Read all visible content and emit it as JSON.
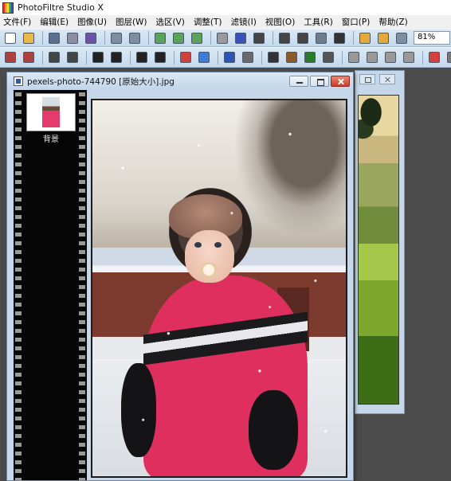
{
  "window": {
    "title": "PhotoFiltre Studio X"
  },
  "menu": {
    "items": [
      {
        "label": "文件(F)"
      },
      {
        "label": "编辑(E)"
      },
      {
        "label": "图像(U)"
      },
      {
        "label": "图层(W)"
      },
      {
        "label": "选区(V)"
      },
      {
        "label": "调整(T)"
      },
      {
        "label": "滤镜(I)"
      },
      {
        "label": "视图(O)"
      },
      {
        "label": "工具(R)"
      },
      {
        "label": "窗口(P)"
      },
      {
        "label": "帮助(Z)"
      }
    ]
  },
  "toolbar1": {
    "buttons": [
      {
        "icon": "new-file-icon",
        "color": "#ffffff"
      },
      {
        "icon": "open-folder-icon",
        "color": "#e9b84a"
      },
      {
        "icon": "save-icon",
        "color": "#5a6f8e"
      },
      {
        "icon": "print-icon",
        "color": "#8c8fa3"
      },
      {
        "icon": "scan-icon",
        "color": "#6a52a8"
      },
      {
        "icon": "undo-icon",
        "color": "#7d8ea0"
      },
      {
        "icon": "redo-icon",
        "color": "#7d8ea0"
      },
      {
        "icon": "copy-icon",
        "color": "#5aa35a"
      },
      {
        "icon": "paste-icon",
        "color": "#5aa35a"
      },
      {
        "icon": "paste-new-icon",
        "color": "#5aa35a"
      },
      {
        "icon": "grayscale-icon",
        "color": "#9a9a9a"
      },
      {
        "icon": "colors-icon",
        "color": "#3a4fb8"
      },
      {
        "icon": "help-icon",
        "color": "#444444"
      },
      {
        "icon": "image-size-icon",
        "color": "#444444"
      },
      {
        "icon": "canvas-size-icon",
        "color": "#444444"
      },
      {
        "icon": "crop-icon",
        "color": "#6d7d8e"
      },
      {
        "icon": "text-icon",
        "color": "#333333"
      },
      {
        "icon": "plugin-icon",
        "color": "#e3a93b"
      },
      {
        "icon": "stamp-icon",
        "color": "#e3a93b"
      },
      {
        "icon": "screen-icon",
        "color": "#7c8fa3"
      }
    ],
    "zoom": "81%"
  },
  "toolbar2": {
    "buttons": [
      {
        "icon": "auto-levels-icon",
        "color": "#b04040"
      },
      {
        "icon": "auto-contrast-icon",
        "color": "#b04040"
      },
      {
        "icon": "brightness-minus-icon",
        "color": "#444444"
      },
      {
        "icon": "brightness-plus-icon",
        "color": "#444444"
      },
      {
        "icon": "contrast-minus-icon",
        "color": "#222222"
      },
      {
        "icon": "contrast-plus-icon",
        "color": "#222222"
      },
      {
        "icon": "gamma-minus-icon",
        "color": "#222222"
      },
      {
        "icon": "gamma-plus-icon",
        "color": "#222222"
      },
      {
        "icon": "saturation-minus-icon",
        "color": "#d23f3f"
      },
      {
        "icon": "saturation-plus-icon",
        "color": "#3f7bd2"
      },
      {
        "icon": "histogram-icon",
        "color": "#2e56b0"
      },
      {
        "icon": "color-balance-icon",
        "color": "#6a6a6a"
      },
      {
        "icon": "grid-icon",
        "color": "#333333"
      },
      {
        "icon": "mosaic-icon",
        "color": "#8a5a2a"
      },
      {
        "icon": "pixelate-icon",
        "color": "#2a7a2a"
      },
      {
        "icon": "blur-icon",
        "color": "#555555"
      },
      {
        "icon": "drop-icon",
        "color": "#999999"
      },
      {
        "icon": "drop-outline-icon",
        "color": "#999999"
      },
      {
        "icon": "sharpen-icon",
        "color": "#999999"
      },
      {
        "icon": "soften-icon",
        "color": "#999999"
      },
      {
        "icon": "gradient-icon",
        "color": "#d84040"
      },
      {
        "icon": "palette-icon",
        "color": "#777777"
      }
    ]
  },
  "document": {
    "title": "pexels-photo-744790 [原始大小].jpg",
    "layer_name": "背景"
  }
}
